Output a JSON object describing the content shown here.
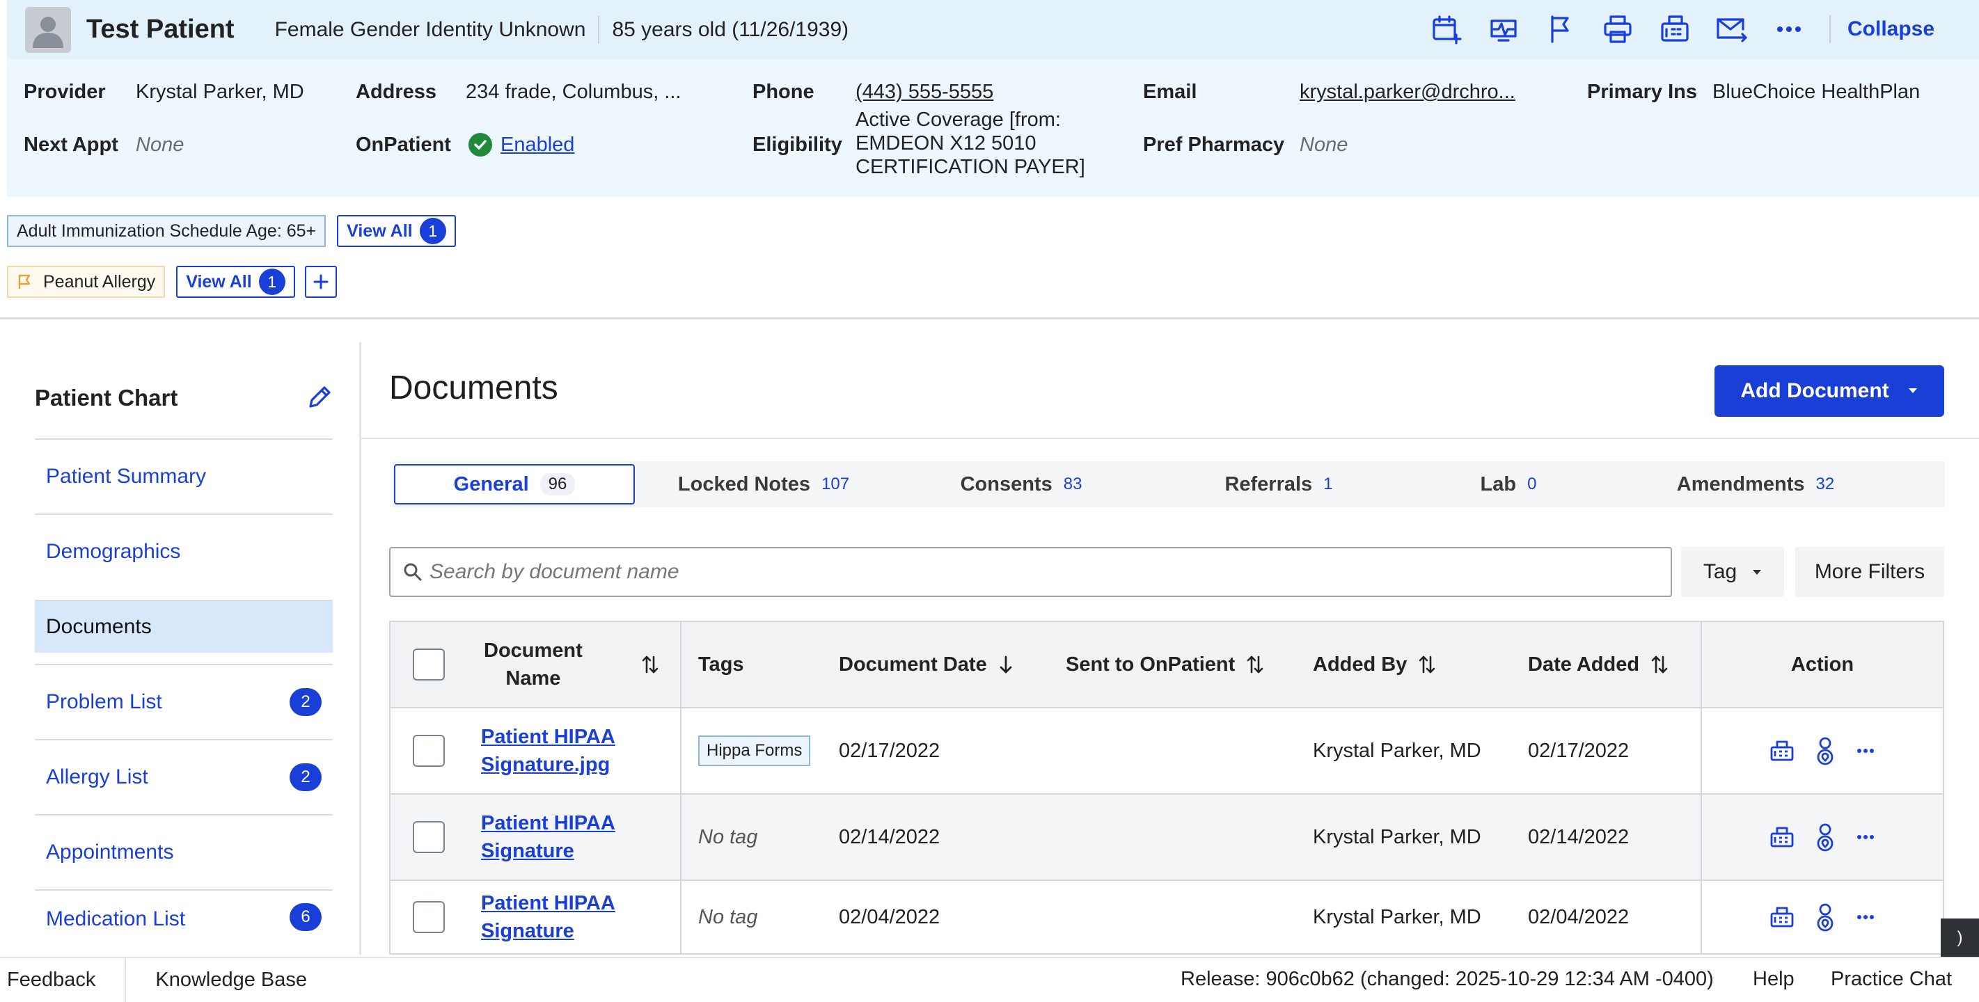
{
  "patient": {
    "name": "Test Patient",
    "gender": "Female Gender Identity Unknown",
    "age": "85 years old (11/26/1939)",
    "collapse_label": "Collapse"
  },
  "header_icons": [
    "calendar-plus-icon",
    "vitals-icon",
    "flag-icon",
    "print-icon",
    "fax-icon",
    "mail-forward-icon",
    "more-icon"
  ],
  "info": {
    "provider_label": "Provider",
    "provider_value": "Krystal Parker, MD",
    "address_label": "Address",
    "address_value": "234 frade, Columbus, ...",
    "phone_label": "Phone",
    "phone_value": "(443) 555-5555",
    "email_label": "Email",
    "email_value": "krystal.parker@drchro...",
    "primary_ins_label": "Primary Ins",
    "primary_ins_value": "BlueChoice HealthPlan",
    "next_appt_label": "Next Appt",
    "next_appt_value": "None",
    "onpatient_label": "OnPatient",
    "onpatient_value": "Enabled",
    "eligibility_label": "Eligibility",
    "eligibility_line1": "Active Coverage [from:",
    "eligibility_line2": "EMDEON X12 5010",
    "eligibility_line3": "CERTIFICATION PAYER]",
    "pref_pharmacy_label": "Pref Pharmacy",
    "pref_pharmacy_value": "None"
  },
  "alerts": {
    "immunization_chip": "Adult Immunization Schedule Age: 65+",
    "immunization_view_all": "View All",
    "immunization_count": "1",
    "allergy_chip": "Peanut Allergy",
    "allergy_view_all": "View All",
    "allergy_count": "1"
  },
  "sidebar": {
    "title": "Patient Chart",
    "items": [
      {
        "label": "Patient Summary",
        "badge": ""
      },
      {
        "label": "Demographics",
        "badge": ""
      },
      {
        "label": "Documents",
        "badge": "",
        "active": true
      },
      {
        "label": "Problem List",
        "badge": "2"
      },
      {
        "label": "Allergy List",
        "badge": "2"
      },
      {
        "label": "Appointments",
        "badge": ""
      },
      {
        "label": "Medication List",
        "badge": "6"
      }
    ]
  },
  "main": {
    "title": "Documents",
    "add_button": "Add Document",
    "tabs": [
      {
        "label": "General",
        "count": "96",
        "active": true
      },
      {
        "label": "Locked Notes",
        "count": "107"
      },
      {
        "label": "Consents",
        "count": "83"
      },
      {
        "label": "Referrals",
        "count": "1"
      },
      {
        "label": "Lab",
        "count": "0"
      },
      {
        "label": "Amendments",
        "count": "32"
      }
    ],
    "search_placeholder": "Search by document name",
    "tag_filter": "Tag",
    "more_filters": "More Filters"
  },
  "table": {
    "headers": {
      "name_line1": "Document",
      "name_line2": "Name",
      "tags": "Tags",
      "document_date": "Document Date",
      "sent": "Sent to OnPatient",
      "added_by": "Added By",
      "date_added": "Date Added",
      "action": "Action"
    },
    "rows": [
      {
        "name_line1": "Patient HIPAA",
        "name_line2": "Signature.jpg",
        "tag": "Hippa Forms",
        "document_date": "02/17/2022",
        "sent": "",
        "added_by": "Krystal Parker, MD",
        "date_added": "02/17/2022"
      },
      {
        "name_line1": "Patient HIPAA",
        "name_line2": "Signature",
        "tag": "No tag",
        "document_date": "02/14/2022",
        "sent": "",
        "added_by": "Krystal Parker, MD",
        "date_added": "02/14/2022"
      },
      {
        "name_line1": "Patient HIPAA",
        "name_line2": "Signature",
        "tag": "No tag",
        "document_date": "02/04/2022",
        "sent": "",
        "added_by": "Krystal Parker, MD",
        "date_added": "02/04/2022"
      }
    ]
  },
  "footer": {
    "feedback": "Feedback",
    "knowledge_base": "Knowledge Base",
    "release": "Release: 906c0b62 (changed: 2025-10-29 12:34 AM -0400)",
    "help": "Help",
    "practice_chat": "Practice Chat",
    "side_tab": ")"
  },
  "colors": {
    "accent": "#1a3fd6",
    "header_bg": "#e3f1fb",
    "info_bg": "#eef7fd",
    "active_item_bg": "#d7e8fa",
    "enabled_green": "#1f8a3a"
  }
}
